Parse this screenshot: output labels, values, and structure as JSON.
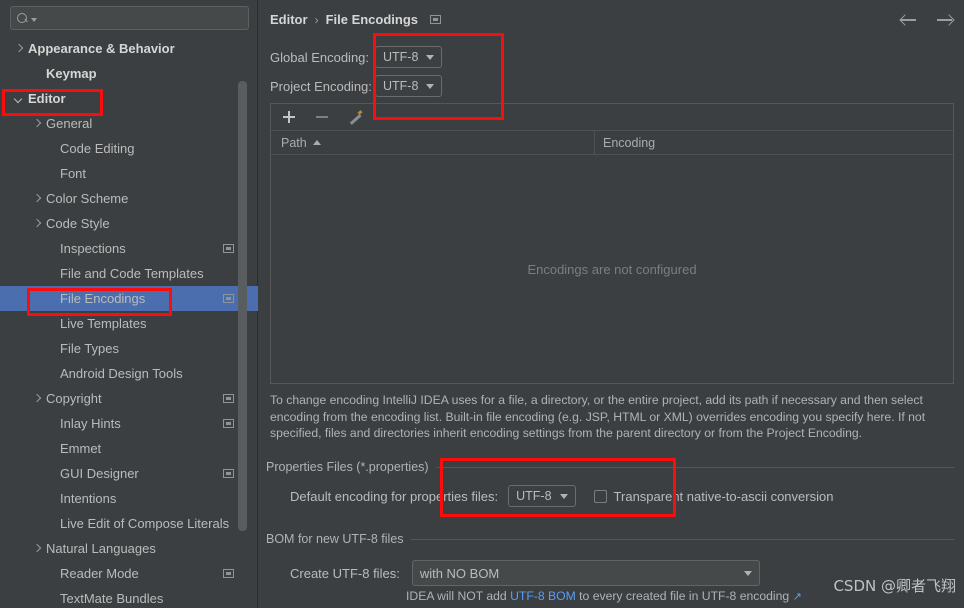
{
  "search": {
    "placeholder": "",
    "value": "",
    "icon": "search-icon"
  },
  "sidebar": {
    "items": [
      {
        "label": "Appearance & Behavior",
        "arrow": "right",
        "indent": 14,
        "bold": true,
        "badge": false,
        "selected": false
      },
      {
        "label": "Keymap",
        "arrow": "none",
        "indent": 32,
        "bold": true,
        "badge": false,
        "selected": false
      },
      {
        "label": "Editor",
        "arrow": "down",
        "indent": 14,
        "bold": true,
        "badge": false,
        "selected": false
      },
      {
        "label": "General",
        "arrow": "right",
        "indent": 32,
        "bold": false,
        "badge": false,
        "selected": false
      },
      {
        "label": "Code Editing",
        "arrow": "none",
        "indent": 46,
        "bold": false,
        "badge": false,
        "selected": false
      },
      {
        "label": "Font",
        "arrow": "none",
        "indent": 46,
        "bold": false,
        "badge": false,
        "selected": false
      },
      {
        "label": "Color Scheme",
        "arrow": "right",
        "indent": 32,
        "bold": false,
        "badge": false,
        "selected": false
      },
      {
        "label": "Code Style",
        "arrow": "right",
        "indent": 32,
        "bold": false,
        "badge": false,
        "selected": false
      },
      {
        "label": "Inspections",
        "arrow": "none",
        "indent": 46,
        "bold": false,
        "badge": true,
        "selected": false
      },
      {
        "label": "File and Code Templates",
        "arrow": "none",
        "indent": 46,
        "bold": false,
        "badge": false,
        "selected": false
      },
      {
        "label": "File Encodings",
        "arrow": "none",
        "indent": 46,
        "bold": false,
        "badge": true,
        "selected": true
      },
      {
        "label": "Live Templates",
        "arrow": "none",
        "indent": 46,
        "bold": false,
        "badge": false,
        "selected": false
      },
      {
        "label": "File Types",
        "arrow": "none",
        "indent": 46,
        "bold": false,
        "badge": false,
        "selected": false
      },
      {
        "label": "Android Design Tools",
        "arrow": "none",
        "indent": 46,
        "bold": false,
        "badge": false,
        "selected": false
      },
      {
        "label": "Copyright",
        "arrow": "right",
        "indent": 32,
        "bold": false,
        "badge": true,
        "selected": false
      },
      {
        "label": "Inlay Hints",
        "arrow": "none",
        "indent": 46,
        "bold": false,
        "badge": true,
        "selected": false
      },
      {
        "label": "Emmet",
        "arrow": "none",
        "indent": 46,
        "bold": false,
        "badge": false,
        "selected": false
      },
      {
        "label": "GUI Designer",
        "arrow": "none",
        "indent": 46,
        "bold": false,
        "badge": true,
        "selected": false
      },
      {
        "label": "Intentions",
        "arrow": "none",
        "indent": 46,
        "bold": false,
        "badge": false,
        "selected": false
      },
      {
        "label": "Live Edit of Compose Literals",
        "arrow": "none",
        "indent": 46,
        "bold": false,
        "badge": false,
        "selected": false
      },
      {
        "label": "Natural Languages",
        "arrow": "right",
        "indent": 32,
        "bold": false,
        "badge": false,
        "selected": false
      },
      {
        "label": "Reader Mode",
        "arrow": "none",
        "indent": 46,
        "bold": false,
        "badge": true,
        "selected": false
      },
      {
        "label": "TextMate Bundles",
        "arrow": "none",
        "indent": 46,
        "bold": false,
        "badge": false,
        "selected": false
      }
    ]
  },
  "breadcrumb": {
    "root": "Editor",
    "separator": "›",
    "current": "File Encodings"
  },
  "nav": {
    "back_icon": "arrow-left-icon",
    "forward_icon": "arrow-right-icon"
  },
  "encodings": {
    "global_label": "Global Encoding:",
    "global_value": "UTF-8",
    "project_label": "Project Encoding:",
    "project_value": "UTF-8"
  },
  "toolbar": {
    "add_icon": "plus-icon",
    "remove_icon": "minus-icon",
    "edit_icon": "pencil-icon"
  },
  "table": {
    "col_path": "Path",
    "col_encoding": "Encoding",
    "sort_icon": "sort-ascending-icon",
    "empty_message": "Encodings are not configured"
  },
  "description": "To change encoding IntelliJ IDEA uses for a file, a directory, or the entire project, add its path if necessary and then select encoding from the encoding list. Built-in file encoding (e.g. JSP, HTML or XML) overrides encoding you specify here. If not specified, files and directories inherit encoding settings from the parent directory or from the Project Encoding.",
  "properties_group": {
    "title": "Properties Files (*.properties)",
    "default_label": "Default encoding for properties files:",
    "default_value": "UTF-8",
    "checkbox_label": "Transparent native-to-ascii conversion",
    "checkbox_checked": false
  },
  "bom_group": {
    "title": "BOM for new UTF-8 files",
    "create_label": "Create UTF-8 files:",
    "create_value": "with NO BOM",
    "hint_prefix": "IDEA will NOT add ",
    "hint_link": "UTF-8 BOM",
    "hint_suffix": " to every created file in UTF-8 encoding ",
    "hint_external_icon": "↗"
  },
  "watermark": "CSDN @卿者飞翔",
  "colors": {
    "background": "#3c3f41",
    "selection": "#4b6eaf",
    "annotation": "#fb0d0d",
    "link": "#589df6",
    "text": "#bbbbbb"
  }
}
